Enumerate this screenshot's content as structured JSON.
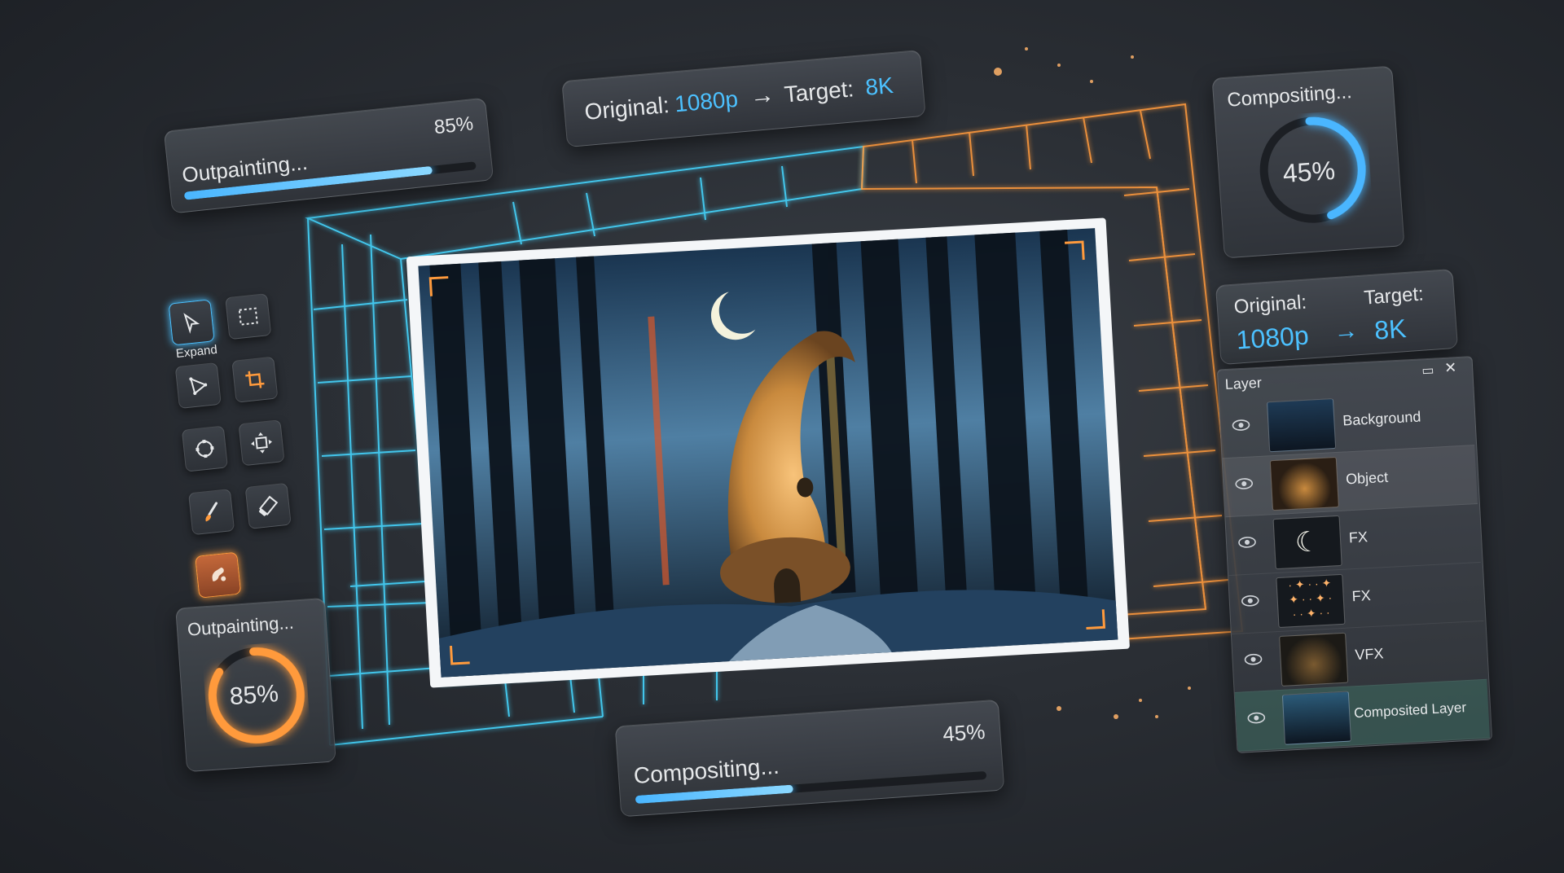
{
  "top_banner": {
    "original_label": "Original:",
    "original_value": "1080p",
    "arrow": "→",
    "target_label": "Target:",
    "target_value": "8K"
  },
  "outpaint_bar": {
    "label": "Outpainting...",
    "percent_text": "85%",
    "progress": 0.85
  },
  "compositing_ring": {
    "label": "Compositing...",
    "percent_text": "45%",
    "progress": 0.45
  },
  "res_card": {
    "original_label": "Original:",
    "target_label": "Target:",
    "original_value": "1080p",
    "arrow": "→",
    "target_value": "8K"
  },
  "outpaint_ring": {
    "label": "Outpainting...",
    "percent_text": "85%",
    "progress": 0.85
  },
  "compositing_bar": {
    "label": "Compositing...",
    "percent_text": "45%",
    "progress": 0.45
  },
  "toolbar": {
    "expand_label": "Expand"
  },
  "layers": {
    "title": "Layer",
    "items": [
      {
        "label": "Background"
      },
      {
        "label": "Object"
      },
      {
        "label": "FX"
      },
      {
        "label": "FX"
      },
      {
        "label": "VFX"
      },
      {
        "label": "Composited Layer"
      }
    ]
  },
  "colors": {
    "accent_blue": "#4cc1ff",
    "accent_orange": "#ff9a3c",
    "grid_cyan": "#45d6ff"
  }
}
